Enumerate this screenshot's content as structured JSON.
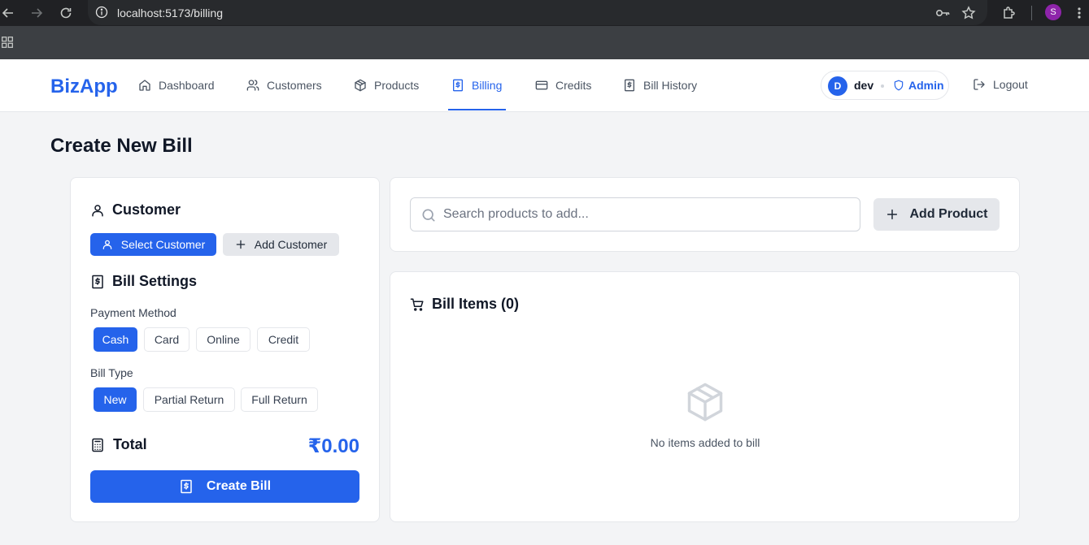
{
  "browser": {
    "url": "localhost:5173/billing",
    "profile_initial": "S"
  },
  "app": {
    "logo": "BizApp",
    "nav": [
      {
        "label": "Dashboard",
        "icon": "home-icon",
        "active": false
      },
      {
        "label": "Customers",
        "icon": "users-icon",
        "active": false
      },
      {
        "label": "Products",
        "icon": "package-icon",
        "active": false
      },
      {
        "label": "Billing",
        "icon": "receipt-icon",
        "active": true
      },
      {
        "label": "Credits",
        "icon": "credit-card-icon",
        "active": false
      },
      {
        "label": "Bill History",
        "icon": "receipt-icon",
        "active": false
      }
    ],
    "user": {
      "initial": "D",
      "name": "dev",
      "role": "Admin"
    },
    "logout_label": "Logout",
    "accent_color": "#2563eb"
  },
  "page": {
    "title": "Create New Bill"
  },
  "customer": {
    "heading": "Customer",
    "select_label": "Select Customer",
    "add_label": "Add Customer"
  },
  "settings": {
    "heading": "Bill Settings",
    "payment_method_label": "Payment Method",
    "payment_methods": [
      "Cash",
      "Card",
      "Online",
      "Credit"
    ],
    "payment_selected": "Cash",
    "bill_type_label": "Bill Type",
    "bill_types": [
      "New",
      "Partial Return",
      "Full Return"
    ],
    "bill_type_selected": "New"
  },
  "total": {
    "label": "Total",
    "value": "₹0.00"
  },
  "create_bill_label": "Create Bill",
  "search": {
    "placeholder": "Search products to add...",
    "value": ""
  },
  "add_product_label": "Add Product",
  "bill_items": {
    "heading": "Bill Items (0)",
    "empty_text": "No items added to bill"
  }
}
